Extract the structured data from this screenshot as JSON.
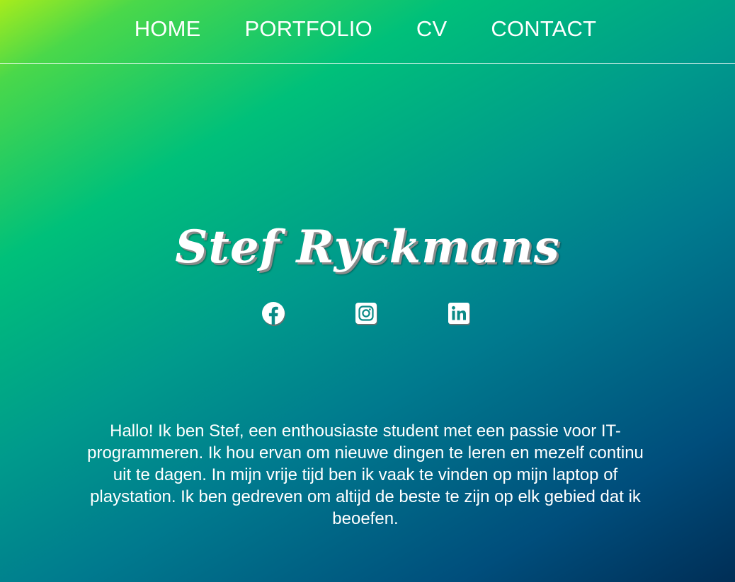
{
  "nav": {
    "items": [
      {
        "label": "HOME"
      },
      {
        "label": "PORTFOLIO"
      },
      {
        "label": "CV"
      },
      {
        "label": "CONTACT"
      }
    ]
  },
  "hero": {
    "name": "Stef Ryckmans"
  },
  "socials": [
    {
      "icon": "facebook-icon"
    },
    {
      "icon": "instagram-icon"
    },
    {
      "icon": "linkedin-icon"
    }
  ],
  "about": {
    "text": "Hallo! Ik ben Stef, een enthousiaste student met een passie voor IT-programmeren. Ik hou ervan om nieuwe dingen te leren en mezelf continu uit te dagen. In mijn vrije tijd ben ik vaak te vinden op mijn laptop of playstation. Ik ben gedreven om altijd de beste te zijn op elk gebied dat ik beoefen."
  },
  "colors": {
    "gradient_start": "#a7ec1c",
    "gradient_mid": "#00c07a",
    "gradient_end": "#002e56",
    "text": "#ffffff"
  }
}
